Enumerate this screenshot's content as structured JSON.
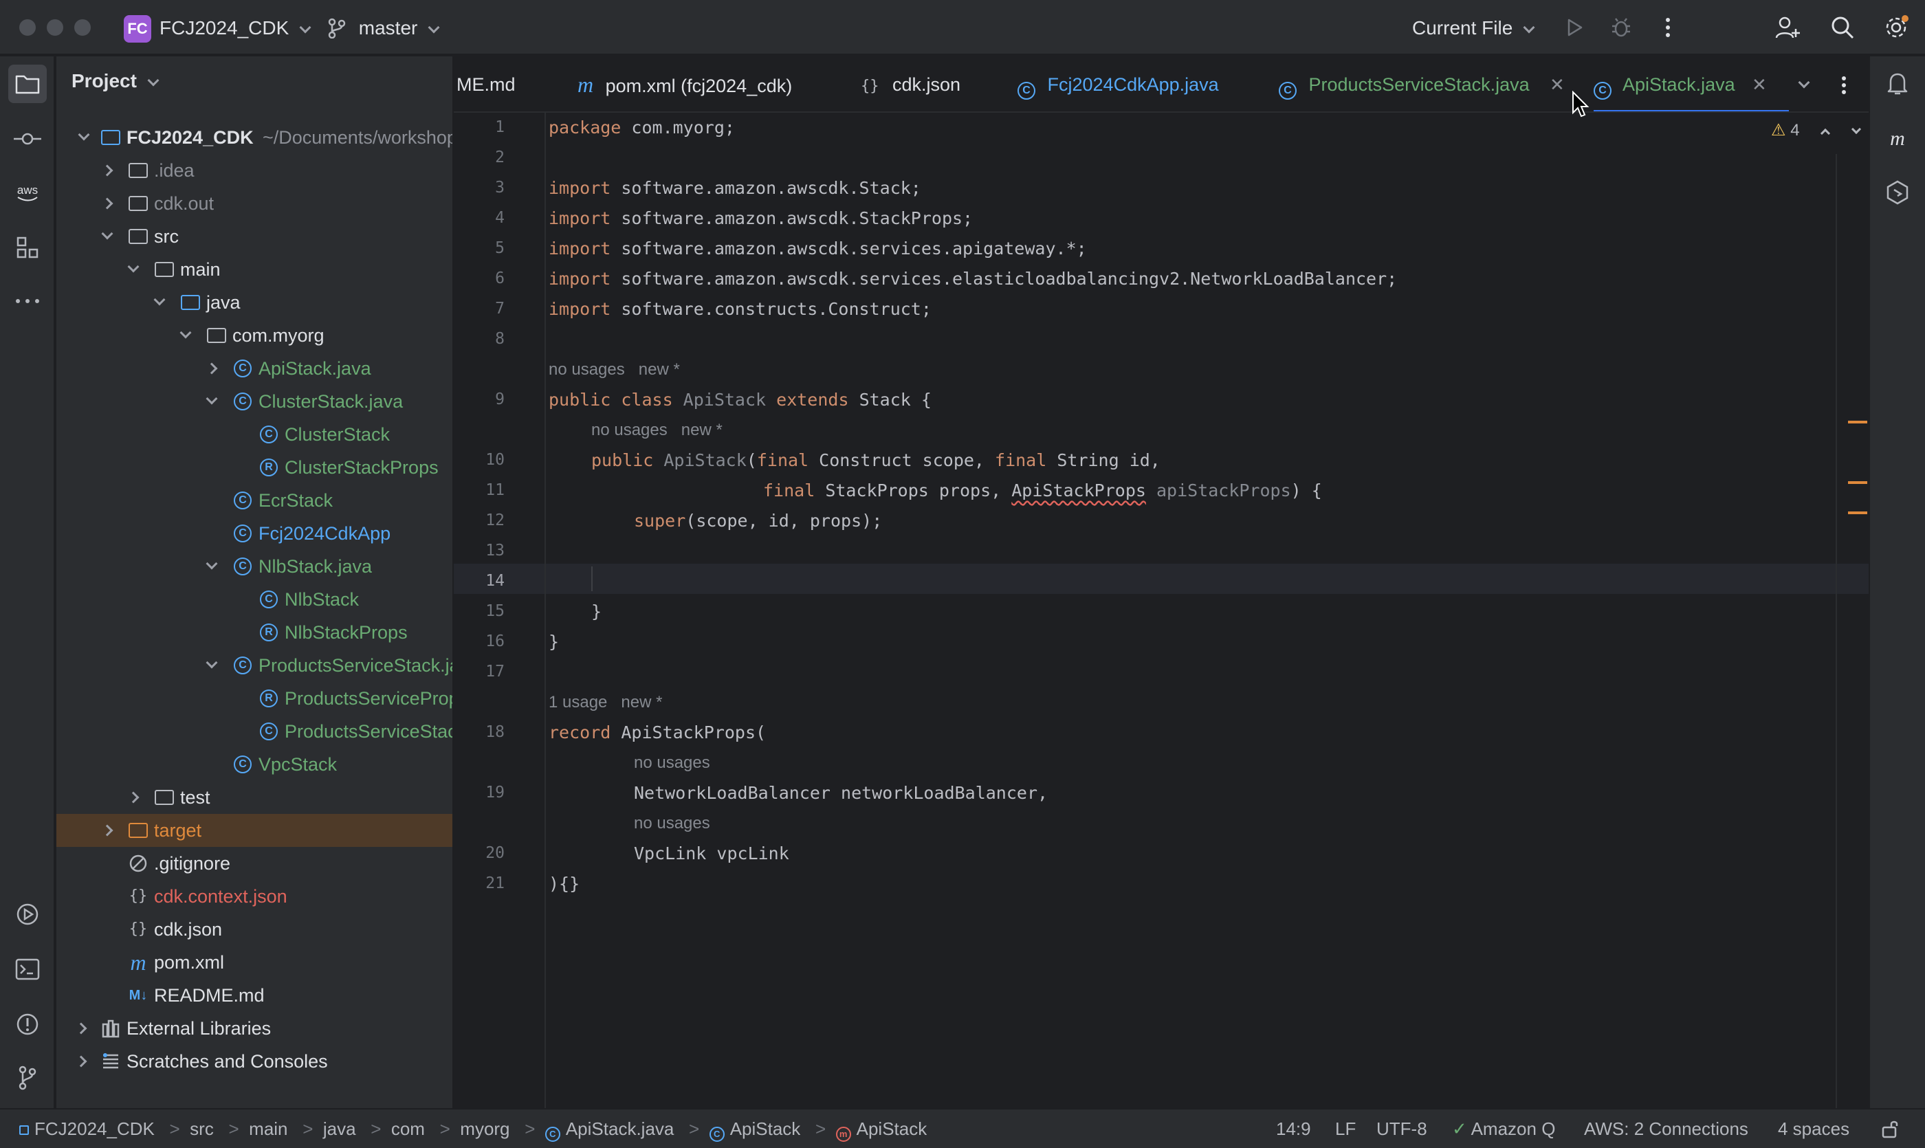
{
  "titlebar": {
    "project_badge": "FC",
    "project_name": "FCJ2024_CDK",
    "branch": "master",
    "run_config": "Current File"
  },
  "panel": {
    "title": "Project",
    "tree": [
      {
        "label": "FCJ2024_CDK",
        "suffix": "~/Documents/workshop",
        "kind": "module"
      },
      {
        "label": ".idea",
        "kind": "folder"
      },
      {
        "label": "cdk.out",
        "kind": "folder"
      },
      {
        "label": "src",
        "kind": "folder"
      },
      {
        "label": "main",
        "kind": "folder"
      },
      {
        "label": "java",
        "kind": "folder"
      },
      {
        "label": "com.myorg",
        "kind": "package"
      },
      {
        "label": "ApiStack.java",
        "kind": "class"
      },
      {
        "label": "ClusterStack.java",
        "kind": "class"
      },
      {
        "label": "ClusterStack",
        "kind": "class"
      },
      {
        "label": "ClusterStackProps",
        "kind": "record"
      },
      {
        "label": "EcrStack",
        "kind": "class"
      },
      {
        "label": "Fcj2024CdkApp",
        "kind": "class"
      },
      {
        "label": "NlbStack.java",
        "kind": "class"
      },
      {
        "label": "NlbStack",
        "kind": "class"
      },
      {
        "label": "NlbStackProps",
        "kind": "record"
      },
      {
        "label": "ProductsServiceStack.java",
        "kind": "class"
      },
      {
        "label": "ProductsServiceProps",
        "kind": "record"
      },
      {
        "label": "ProductsServiceStack",
        "kind": "class"
      },
      {
        "label": "VpcStack",
        "kind": "class"
      },
      {
        "label": "test",
        "kind": "folder"
      },
      {
        "label": "target",
        "kind": "folder"
      },
      {
        "label": ".gitignore",
        "kind": "ignore"
      },
      {
        "label": "cdk.context.json",
        "kind": "json"
      },
      {
        "label": "cdk.json",
        "kind": "json"
      },
      {
        "label": "pom.xml",
        "kind": "maven"
      },
      {
        "label": "README.md",
        "kind": "markdown"
      },
      {
        "label": "External Libraries",
        "kind": "lib"
      },
      {
        "label": "Scratches and Consoles",
        "kind": "scratch"
      }
    ]
  },
  "tabs": [
    {
      "label": "ME.md"
    },
    {
      "label": "pom.xml (fcj2024_cdk)"
    },
    {
      "label": "cdk.json"
    },
    {
      "label": "Fcj2024CdkApp.java"
    },
    {
      "label": "ProductsServiceStack.java"
    },
    {
      "label": "ApiStack.java"
    }
  ],
  "editor": {
    "warning_count": "4",
    "hints": {
      "h1": "no usages   new *",
      "h2": "no usages   new *",
      "h3": "1 usage   new *",
      "h4": "no usages",
      "h5": "no usages"
    },
    "lines": {
      "l1a": "package ",
      "l1b": "com.myorg;",
      "l3": "software.amazon.awscdk.Stack;",
      "l4": "software.amazon.awscdk.StackProps;",
      "l5": "software.amazon.awscdk.services.apigateway.*;",
      "l6": "software.amazon.awscdk.services.elasticloadbalancingv2.NetworkLoadBalancer;",
      "l7": "software.constructs.Construct;",
      "import_kw": "import ",
      "public_kw": "public ",
      "class_kw": "class ",
      "extends_kw": " extends ",
      "final_kw": "final ",
      "record_kw": "record ",
      "l9_name": "ApiStack",
      "l9_tail": "Stack {",
      "l10_name": "ApiStack",
      "l10_a": "(",
      "l10_b": "Construct scope, ",
      "l10_c": "String id,",
      "l11_a": "StackProps props, ",
      "l11_err": "ApiStackProps",
      "l11_param": " apiStackProps",
      "l11_tail": ") {",
      "l12_fn": "super",
      "l12_tail": "(scope, id, props);",
      "l15": "}",
      "l16": "}",
      "l18": "ApiStackProps(",
      "l19": "NetworkLoadBalancer networkLoadBalancer,",
      "l20": "VpcLink vpcLink",
      "l21": "){}"
    },
    "line_numbers": [
      "1",
      "2",
      "3",
      "4",
      "5",
      "6",
      "7",
      "8",
      "9",
      "10",
      "11",
      "12",
      "13",
      "14",
      "15",
      "16",
      "17",
      "18",
      "19",
      "20",
      "21"
    ]
  },
  "status": {
    "crumbs": [
      "FCJ2024_CDK",
      "src",
      "main",
      "java",
      "com",
      "myorg",
      "ApiStack.java",
      "ApiStack",
      "ApiStack"
    ],
    "position": "14:9",
    "line_sep": "LF",
    "encoding": "UTF-8",
    "amazon_q": "Amazon Q",
    "aws": "AWS: 2 Connections",
    "indent": "4 spaces"
  },
  "colors": {
    "accent": "#3574f0",
    "class_icon": "#56a8f5",
    "added_file": "#6aab73",
    "ignored": "#e08a3c",
    "keyword": "#cf8e6d"
  }
}
